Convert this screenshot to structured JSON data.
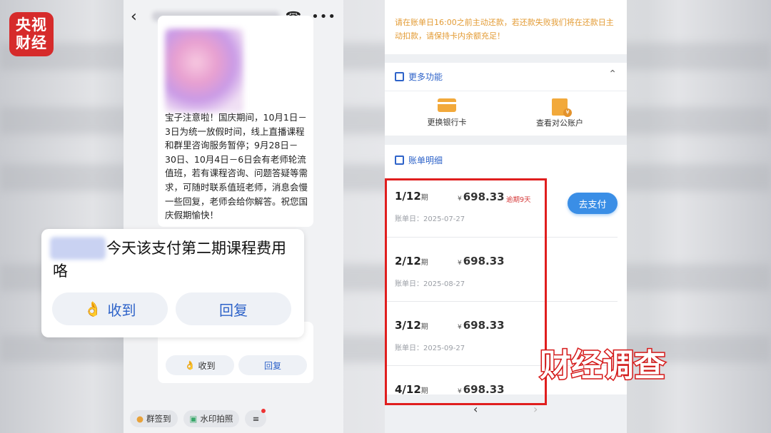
{
  "logo": {
    "line1": "央视",
    "line2": "财经"
  },
  "chat": {
    "back_icon": "chevron-left-icon",
    "call_icon": "phone-icon",
    "more_icon": "more-icon",
    "message": "宝子注意啦！国庆期间，10月1日－3日为统一放假时间，线上直播课程和群里咨询服务暂停；9月28日－30日、10月4日－6日会有老师轮流值班，若有课程咨询、问题答疑等需求，可随时联系值班老师，消息会慢一些回复，老师会给你解答。祝您国庆假期愉快！",
    "receive_label": "收到",
    "reply_label": "回复",
    "toolbar": {
      "checkin": "群签到",
      "watermark": "水印拍照"
    }
  },
  "popup": {
    "text": "今天该支付第二期课程费用咯",
    "receive_label": "收到",
    "reply_label": "回复"
  },
  "bill_app": {
    "notice": "请在账单日16:00之前主动还款，若还款失败我们将在还款日主动扣款，请保持卡内余额充足！",
    "more_functions_title": "更多功能",
    "change_card_label": "更换银行卡",
    "view_account_label": "查看对公账户",
    "bill_detail_title": "账单明细",
    "currency": "¥",
    "period_unit": "期",
    "bill_date_label": "账单日：",
    "bills": [
      {
        "period": "1/12",
        "amount": "698.33",
        "status": "逾期9天",
        "date": "2025-07-27"
      },
      {
        "period": "2/12",
        "amount": "698.33",
        "status": "",
        "date": "2025-08-27"
      },
      {
        "period": "3/12",
        "amount": "698.33",
        "status": "",
        "date": "2025-09-27"
      },
      {
        "period": "4/12",
        "amount": "698.33",
        "status": "",
        "date": ""
      }
    ],
    "pay_button": "去支付"
  },
  "caption": "财经调查"
}
